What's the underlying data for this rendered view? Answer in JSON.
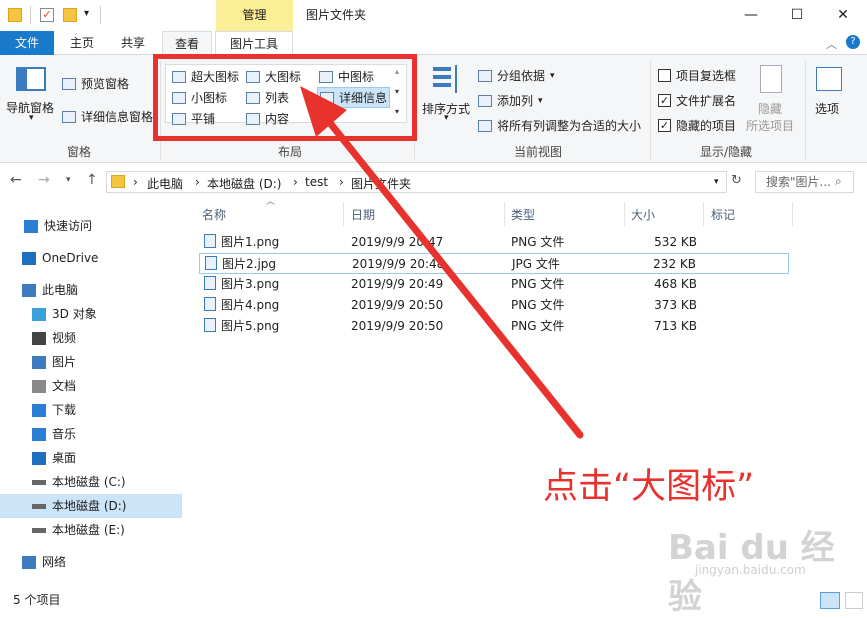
{
  "titlebar": {
    "manage_tab": "管理",
    "title": "图片文件夹"
  },
  "tabs": {
    "file": "文件",
    "home": "主页",
    "share": "共享",
    "view": "查看",
    "picture_tools": "图片工具"
  },
  "ribbon": {
    "pane": {
      "nav_pane": "导航窗格",
      "preview_pane": "预览窗格",
      "details_pane": "详细信息窗格",
      "group_label": "窗格"
    },
    "layout": {
      "extra_large": "超大图标",
      "large": "大图标",
      "medium": "中图标",
      "small": "小图标",
      "list": "列表",
      "details": "详细信息",
      "tiles": "平铺",
      "content": "内容",
      "group_label": "布局"
    },
    "current_view": {
      "sort_by": "排序方式",
      "group_by": "分组依据",
      "add_columns": "添加列",
      "fit_columns": "将所有列调整为合适的大小",
      "group_label": "当前视图"
    },
    "show_hide": {
      "item_checkboxes": "项目复选框",
      "file_extensions": "文件扩展名",
      "hidden_items": "隐藏的项目",
      "hide_selected": "隐藏",
      "hide_selected_2": "所选项目",
      "options": "选项",
      "group_label": "显示/隐藏",
      "item_checkboxes_checked": false,
      "file_extensions_checked": true,
      "hidden_items_checked": true
    }
  },
  "address": {
    "crumbs": [
      "此电脑",
      "本地磁盘 (D:)",
      "test",
      "图片文件夹"
    ],
    "search_placeholder": "搜索\"图片..."
  },
  "sidebar": {
    "items": [
      {
        "label": "快速访问",
        "icon": "star-icon"
      },
      {
        "label": "OneDrive",
        "icon": "cloud-icon"
      },
      {
        "label": "此电脑",
        "icon": "computer-icon"
      },
      {
        "label": "3D 对象",
        "icon": "cube-icon"
      },
      {
        "label": "视频",
        "icon": "video-icon"
      },
      {
        "label": "图片",
        "icon": "picture-icon"
      },
      {
        "label": "文档",
        "icon": "document-icon"
      },
      {
        "label": "下载",
        "icon": "download-icon"
      },
      {
        "label": "音乐",
        "icon": "music-icon"
      },
      {
        "label": "桌面",
        "icon": "desktop-icon"
      },
      {
        "label": "本地磁盘 (C:)",
        "icon": "drive-icon"
      },
      {
        "label": "本地磁盘 (D:)",
        "icon": "drive-icon"
      },
      {
        "label": "本地磁盘 (E:)",
        "icon": "drive-icon"
      },
      {
        "label": "网络",
        "icon": "network-icon"
      }
    ]
  },
  "columns": {
    "name": "名称",
    "date": "日期",
    "type": "类型",
    "size": "大小",
    "tags": "标记"
  },
  "files": [
    {
      "name": "图片1.png",
      "date": "2019/9/9 20:47",
      "type": "PNG 文件",
      "size": "532 KB"
    },
    {
      "name": "图片2.jpg",
      "date": "2019/9/9 20:48",
      "type": "JPG 文件",
      "size": "232 KB"
    },
    {
      "name": "图片3.png",
      "date": "2019/9/9 20:49",
      "type": "PNG 文件",
      "size": "468 KB"
    },
    {
      "name": "图片4.png",
      "date": "2019/9/9 20:50",
      "type": "PNG 文件",
      "size": "373 KB"
    },
    {
      "name": "图片5.png",
      "date": "2019/9/9 20:50",
      "type": "PNG 文件",
      "size": "713 KB"
    }
  ],
  "status": {
    "count": "5 个项目"
  },
  "annotation": {
    "callout": "点击“大图标”",
    "watermark": "Bai du 经验",
    "watermark_url": "jingyan.baidu.com"
  },
  "colors": {
    "accent": "#1979ca",
    "annotation_red": "#e8322e",
    "manage_tab": "#fcee97"
  }
}
